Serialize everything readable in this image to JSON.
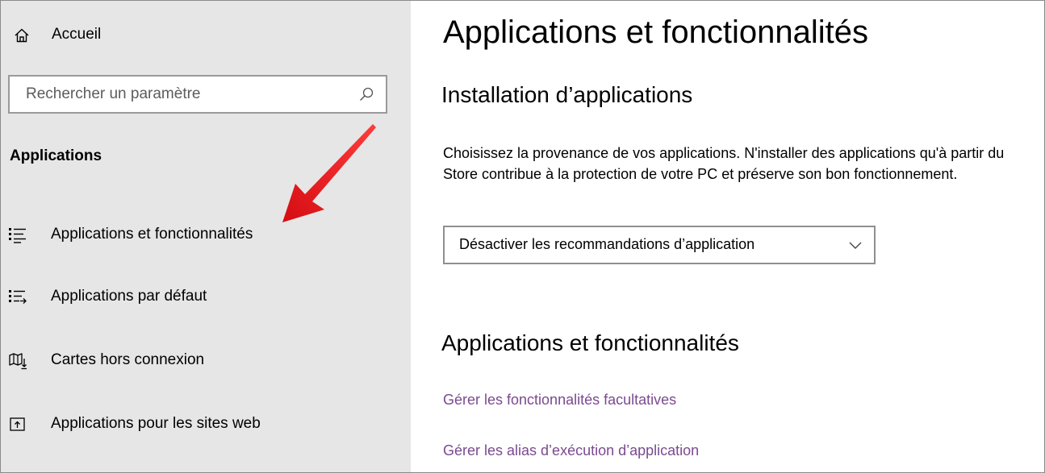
{
  "sidebar": {
    "home_label": "Accueil",
    "search_placeholder": "Rechercher un paramètre",
    "section_title": "Applications",
    "items": [
      {
        "label": "Applications et fonctionnalités",
        "icon": "list-icon"
      },
      {
        "label": "Applications par défaut",
        "icon": "default-apps-icon"
      },
      {
        "label": "Cartes hors connexion",
        "icon": "offline-maps-icon"
      },
      {
        "label": "Applications pour les sites web",
        "icon": "web-apps-icon"
      }
    ]
  },
  "main": {
    "title": "Applications et fonctionnalités",
    "install_heading": "Installation d’applications",
    "install_description": "Choisissez la provenance de vos applications. N'installer des applications qu'à partir du Store contribue à la protection de votre PC et préserve son bon fonctionnement.",
    "dropdown_value": "Désactiver les recommandations d’application",
    "features_heading": "Applications et fonctionnalités",
    "links": [
      "Gérer les fonctionnalités facultatives",
      "Gérer les alias d’exécution d’application"
    ]
  },
  "colors": {
    "sidebar_bg": "#e6e6e6",
    "link": "#7a4a8f",
    "annotation_arrow": "#e8161b"
  }
}
